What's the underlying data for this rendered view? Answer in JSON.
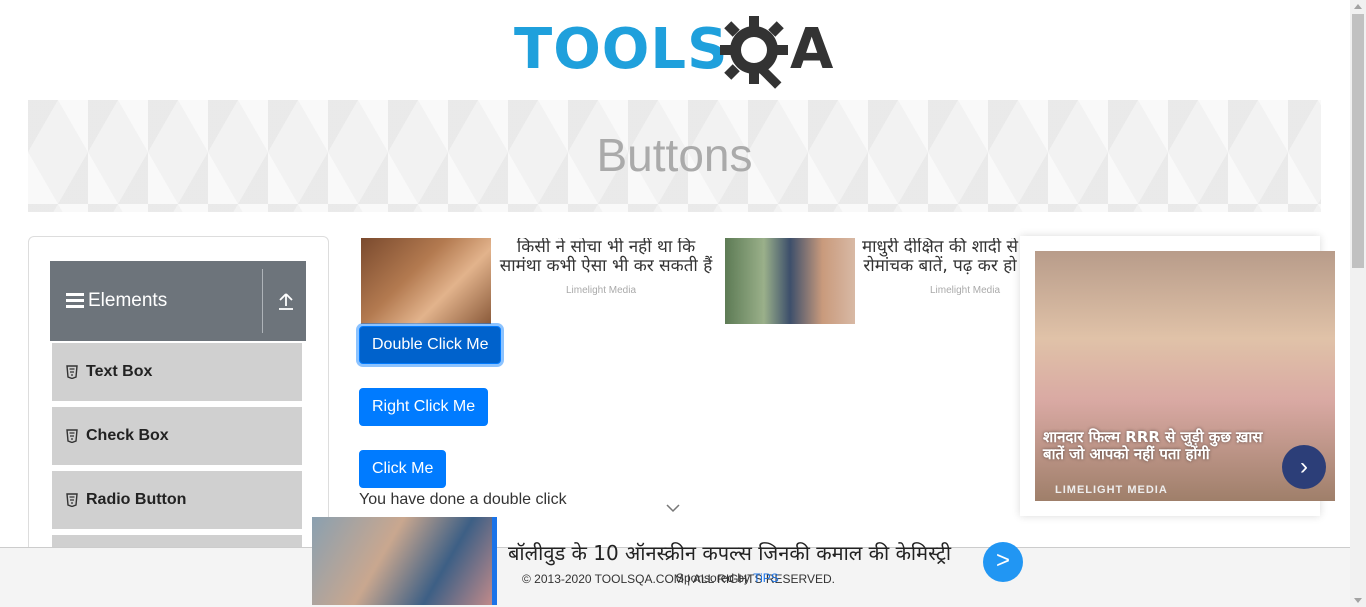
{
  "header": {
    "logo_text": "TOOLS",
    "logo_suffix": "A",
    "logo_gear": "gear-q-icon"
  },
  "banner": {
    "title": "Buttons"
  },
  "sidebar": {
    "group": {
      "label": "Elements",
      "icon": "hamburger-icon",
      "toggle_icon": "upload-icon"
    },
    "items": [
      {
        "label": "Text Box",
        "icon": "html5-icon"
      },
      {
        "label": "Check Box",
        "icon": "html5-icon"
      },
      {
        "label": "Radio Button",
        "icon": "html5-icon"
      }
    ]
  },
  "ads": [
    {
      "line1": "किसी ने सोचा भी नहीं था कि",
      "line2": "सामंथा कभी ऐसा भी कर सकती हैं",
      "source": "Limelight Media"
    },
    {
      "line1": "माधुरी दीक्षित की शादी से",
      "line2": "रोमांचक बातें, पढ़ कर हो",
      "source": "Limelight Media"
    }
  ],
  "buttons": {
    "double_click": "Double Click Me",
    "right_click": "Right Click Me",
    "click": "Click Me"
  },
  "result": {
    "message": "You have done a double click"
  },
  "side_ad": {
    "caption": "शानदार फिल्म RRR से जुड़ी कुछ ख़ास बातें जो आपको नहीं पता होंगी",
    "source": "LIMELIGHT MEDIA",
    "arrow": "›"
  },
  "bottom_ad": {
    "title": "बॉलीवुड के 10 ऑनस्क्रीन कपल्स जिनकी कमाल की केमिस्ट्री",
    "go": ">",
    "sponsor_prefix": "Sponsored by",
    "sponsor_name": "TiPS"
  },
  "footer": {
    "copyright": "© 2013-2020 TOOLSQA.COM | ALL RIGHTS RESERVED."
  }
}
